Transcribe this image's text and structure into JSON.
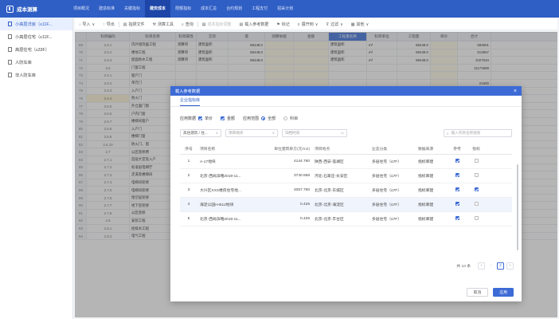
{
  "app": {
    "name": "成本测算"
  },
  "nav": {
    "tabs": [
      "项目概况",
      "建造标准",
      "关键指标",
      "建安成本",
      "限额指标",
      "成本汇总",
      "合约规划",
      "工程支付",
      "招采计划"
    ],
    "active": 3
  },
  "sidebar": {
    "items": [
      {
        "label": "小高层洋房（≤11F..."
      },
      {
        "label": "小高层住宅（≤11F..."
      },
      {
        "label": "高层住宅（≤33F）"
      },
      {
        "label": "人防车库"
      },
      {
        "label": "非人防车库"
      }
    ],
    "active": 0
  },
  "toolbar": {
    "items": [
      {
        "icon": "arrow-down",
        "label": "导入",
        "suffix": "∨"
      },
      {
        "icon": "arrow-up",
        "label": "导出"
      },
      {
        "icon": "doc",
        "label": "指摽文件"
      },
      {
        "icon": "tool",
        "label": "测算工具"
      },
      {
        "icon": "search",
        "label": "查询"
      },
      {
        "icon": "doc",
        "label": "成本指标调整",
        "disabled": true
      },
      {
        "icon": "doc",
        "label": "载入参考数据"
      },
      {
        "icon": "bookmark",
        "label": "标记"
      },
      {
        "icon": "layers",
        "label": "展开到",
        "suffix": "∨"
      },
      {
        "icon": "filter",
        "label": "过滤",
        "suffix": "∨"
      },
      {
        "icon": "more",
        "label": "其他",
        "suffix": "∨"
      }
    ]
  },
  "bg_table": {
    "headers": [
      "科目编码",
      "科目名称",
      "科目属性",
      "计算口径",
      "实际",
      "值",
      "测算依据",
      "金额",
      "工程量名称",
      "科目单位",
      "工程量",
      "单价",
      "合计"
    ],
    "rows": [
      {
        "n": "69",
        "code": "2.5.1",
        "name": "内外墙饰面工程",
        "attr": "测算项",
        "kind": "建筑面积",
        "val": "85448.0",
        "unit": "m²",
        "qty": "85448.0",
        "total": "583601"
      },
      {
        "n": "70",
        "code": "2.5.2",
        "name": "楼地工程",
        "attr": "测算项",
        "kind": "建筑面积",
        "val": "85448.0",
        "unit": "m²",
        "qty": "85448.0",
        "total": "513667"
      },
      {
        "n": "71",
        "code": "2.5.3",
        "name": "屋面防水工程",
        "attr": "测算项",
        "kind": "建筑面积",
        "val": "85448.0",
        "unit": "m²",
        "qty": "85448.0",
        "total": "1027634"
      },
      {
        "n": "72",
        "code": "2.6",
        "name": "门窗工程",
        "attr": "",
        "kind": "",
        "val": "",
        "unit": "",
        "qty": "",
        "total": "11174689"
      },
      {
        "n": "73",
        "code": "2.6.1",
        "name": "窗户门",
        "attr": "",
        "kind": "",
        "val": "",
        "unit": "",
        "qty": "",
        "total": ""
      },
      {
        "n": "74",
        "code": "2.6.2",
        "name": "单元门",
        "attr": "",
        "kind": "",
        "val": "",
        "unit": "",
        "qty": "",
        "total": "21600"
      },
      {
        "n": "75",
        "code": "2.6.3",
        "name": "入户门",
        "attr": "",
        "kind": "",
        "val": "",
        "unit": "",
        "qty": "",
        "total": "398000"
      },
      {
        "n": "76",
        "code": "2.6.4",
        "name": "防火门",
        "attr": "",
        "kind": "",
        "val": "",
        "unit": "",
        "qty": "",
        "total": "90000",
        "yellow": true
      },
      {
        "n": "77",
        "code": "2.6.5",
        "name": "外立面门窗",
        "attr": "",
        "kind": "",
        "val": "",
        "unit": "",
        "qty": "",
        "total": "4952775"
      },
      {
        "n": "78",
        "code": "2.6.6",
        "name": "户内门窗",
        "attr": "",
        "kind": "",
        "val": "",
        "unit": "",
        "qty": "",
        "total": ""
      },
      {
        "n": "79",
        "code": "2.6.7",
        "name": "楼梯间窗户",
        "attr": "",
        "kind": "",
        "val": "",
        "unit": "",
        "qty": "",
        "total": "1869672"
      },
      {
        "n": "80",
        "code": "2.6.8",
        "name": "入户门",
        "attr": "",
        "kind": "",
        "val": "",
        "unit": "",
        "qty": "",
        "total": ""
      },
      {
        "n": "81",
        "code": "2.6.9",
        "name": "楼梯门窗",
        "attr": "",
        "kind": "",
        "val": "",
        "unit": "",
        "qty": "",
        "total": ""
      },
      {
        "n": "82",
        "code": "2.6.10",
        "name": "防火门、窗",
        "attr": "",
        "kind": "",
        "val": "",
        "unit": "",
        "qty": "",
        "total": "2824841"
      },
      {
        "n": "83",
        "code": "2.7",
        "name": "公区装修费",
        "attr": "",
        "kind": "",
        "val": "",
        "unit": "",
        "qty": "",
        "total": "1172500"
      },
      {
        "n": "84",
        "code": "2.7.1",
        "name": "首层大堂及入户",
        "attr": "",
        "kind": "",
        "val": "",
        "unit": "",
        "qty": "",
        "total": "5430"
      },
      {
        "n": "85",
        "code": "2.7.2",
        "name": "标准层电梯厅",
        "attr": "",
        "kind": "",
        "val": "",
        "unit": "",
        "qty": "",
        "total": "5400"
      },
      {
        "n": "86",
        "code": "2.7.3",
        "name": "走道及楼梯间",
        "attr": "",
        "kind": "",
        "val": "",
        "unit": "",
        "qty": "",
        "total": "11000"
      },
      {
        "n": "87",
        "code": "2.7.4",
        "name": "电梯间装修",
        "attr": "",
        "kind": "",
        "val": "",
        "unit": "",
        "qty": "",
        "total": ""
      },
      {
        "n": "88",
        "code": "2.7.5",
        "name": "电梯间装修",
        "attr": "",
        "kind": "",
        "val": "",
        "unit": "",
        "qty": "",
        "total": ""
      },
      {
        "n": "89",
        "code": "2.7.6",
        "name": "架空层装修",
        "attr": "",
        "kind": "",
        "val": "",
        "unit": "",
        "qty": "",
        "total": ""
      },
      {
        "n": "90",
        "code": "2.7.7",
        "name": "地下室装修",
        "attr": "",
        "kind": "",
        "val": "",
        "unit": "",
        "qty": "",
        "total": ""
      },
      {
        "n": "91",
        "code": "2.7.8",
        "name": "公区装修",
        "attr": "",
        "kind": "",
        "val": "",
        "unit": "",
        "qty": "",
        "total": ""
      },
      {
        "n": "92",
        "code": "2.8",
        "name": "安装工程",
        "attr": "",
        "kind": "",
        "val": "",
        "unit": "",
        "qty": "",
        "total": "2889265"
      },
      {
        "n": "93",
        "code": "2.8.1",
        "name": "给排水工程",
        "attr": "测算项",
        "kind": "建筑面积",
        "val": "85448.0",
        "unit": "m²",
        "qty": "85448.0",
        "total": ""
      },
      {
        "n": "94",
        "code": "2.8.2",
        "name": "电气工程",
        "attr": "测算项",
        "kind": "建筑面积",
        "val": "85448.0",
        "unit": "m²",
        "qty": "85448.0",
        "total": ""
      }
    ]
  },
  "modal": {
    "title": "载入参考数据",
    "tab": "企业指标库",
    "filters": {
      "apply_label": "应用数据",
      "unit_price": "单价",
      "amount": "金额",
      "scope_label": "应用范围",
      "all": "全部",
      "subject": "科目"
    },
    "selects": [
      {
        "value": "高住建筑 / 住...",
        "placeholder": ""
      },
      {
        "value": "",
        "placeholder": "项目地点"
      },
      {
        "value": "",
        "placeholder": "归档时间"
      }
    ],
    "search_placeholder": "输入项目名称搜索",
    "headers": [
      "序号",
      "项目名称",
      "单位建筑单方(元/m2)",
      "项目地点",
      "业态分类",
      "数据来源",
      "参考",
      "指标"
    ],
    "rows": [
      {
        "no": "1",
        "name": "A-17地块",
        "price": "4144.760",
        "loc": "陕西-西安-莲湖区",
        "type": "多层住宅（≤7F）",
        "src": "指标库建",
        "ref": true,
        "idx": false
      },
      {
        "no": "2",
        "name": "北京-西局滨略2019-11...",
        "price": "3740.568",
        "loc": "河北-石家庄-长安区",
        "type": "多层住宅（≤7F）",
        "src": "指标库建",
        "ref": true,
        "idx": false
      },
      {
        "no": "3",
        "name": "大兴区XXX楼房住宅地...",
        "price": "4057.760",
        "loc": "北京-北京-东城区",
        "type": "多层住宅（≤7F）",
        "src": "指标库建",
        "ref": true,
        "idx": true
      },
      {
        "no": "4",
        "name": "海淀公园H-B12地块",
        "price": "0.426",
        "loc": "北京-北京-海淀区",
        "type": "多层住宅（≤7F）",
        "src": "指标库建",
        "ref": true,
        "idx": false
      },
      {
        "no": "5",
        "name": "北京-西局滨略2019-11...",
        "price": "0.426",
        "loc": "北京-北京-丰台区",
        "type": "多层住宅（≤7F）",
        "src": "指标库建",
        "ref": true,
        "idx": false
      }
    ],
    "pager": {
      "total": "共 10 条",
      "current": "2"
    },
    "cancel": "取消",
    "apply": "应用"
  },
  "colors": {
    "primary": "#2f5ec4",
    "modal_header": "#3d6bd6",
    "nav_active": "#1d46a8"
  }
}
